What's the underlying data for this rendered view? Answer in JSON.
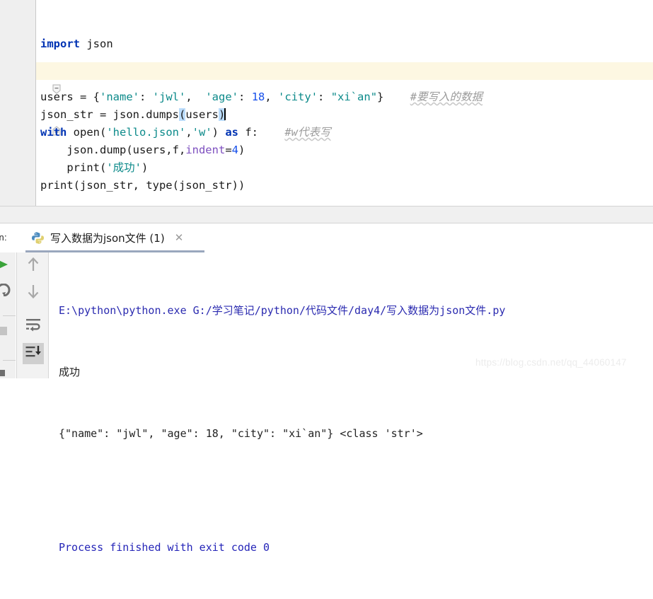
{
  "editor": {
    "lines": [
      {
        "id": "line-import",
        "tokens": [
          {
            "t": "import",
            "c": "kw"
          },
          {
            "t": " json",
            "c": "plain"
          }
        ]
      },
      {
        "id": "line-blank-1",
        "tokens": []
      },
      {
        "id": "line-blank-2",
        "tokens": []
      },
      {
        "id": "line-users",
        "tokens": [
          {
            "t": "users = {",
            "c": "plain"
          },
          {
            "t": "'name'",
            "c": "str"
          },
          {
            "t": ": ",
            "c": "plain"
          },
          {
            "t": "'jwl'",
            "c": "str"
          },
          {
            "t": ",  ",
            "c": "plain"
          },
          {
            "t": "'age'",
            "c": "str"
          },
          {
            "t": ": ",
            "c": "plain"
          },
          {
            "t": "18",
            "c": "num"
          },
          {
            "t": ", ",
            "c": "plain"
          },
          {
            "t": "'city'",
            "c": "str"
          },
          {
            "t": ": ",
            "c": "plain"
          },
          {
            "t": "\"xi`an\"",
            "c": "str"
          },
          {
            "t": "}",
            "c": "plain"
          }
        ],
        "comment": "#要写入的数据"
      },
      {
        "id": "line-json-str",
        "highlighted": true,
        "tokens": [
          {
            "t": "json_str = json.dumps",
            "c": "plain"
          },
          {
            "t": "(",
            "c": "plain brace-hl"
          },
          {
            "t": "users",
            "c": "plain"
          },
          {
            "t": ")",
            "c": "plain brace-hl"
          }
        ],
        "caret": true
      },
      {
        "id": "line-with-open",
        "tokens": [
          {
            "t": "with",
            "c": "kw"
          },
          {
            "t": " open(",
            "c": "plain"
          },
          {
            "t": "'hello.json'",
            "c": "str"
          },
          {
            "t": ",",
            "c": "plain"
          },
          {
            "t": "'w'",
            "c": "str"
          },
          {
            "t": ") ",
            "c": "plain"
          },
          {
            "t": "as",
            "c": "kw"
          },
          {
            "t": " f:",
            "c": "plain"
          }
        ],
        "comment": "#w代表写"
      },
      {
        "id": "line-json-dump",
        "tokens": [
          {
            "t": "    json.dump(users,f,",
            "c": "plain"
          },
          {
            "t": "indent",
            "c": "named"
          },
          {
            "t": "=",
            "c": "plain"
          },
          {
            "t": "4",
            "c": "num"
          },
          {
            "t": ")",
            "c": "plain"
          }
        ]
      },
      {
        "id": "line-print-success",
        "tokens": [
          {
            "t": "    print(",
            "c": "plain"
          },
          {
            "t": "'成功'",
            "c": "str"
          },
          {
            "t": ")",
            "c": "plain"
          }
        ]
      },
      {
        "id": "line-print-jsonstr",
        "tokens": [
          {
            "t": "print(json_str, ",
            "c": "plain"
          },
          {
            "t": "type",
            "c": "plain"
          },
          {
            "t": "(json_str))",
            "c": "plain"
          }
        ]
      }
    ]
  },
  "panel": {
    "run_label": "un:",
    "tab": {
      "icon": "python-icon",
      "label": "写入数据为json文件 (1)",
      "close": "✕"
    },
    "toolbar": [
      {
        "name": "scroll-up-button",
        "icon": "arrow-up-icon",
        "selected": false
      },
      {
        "name": "scroll-down-button",
        "icon": "arrow-down-icon",
        "selected": false
      },
      {
        "name": "soft-wrap-button",
        "icon": "soft-wrap-icon",
        "selected": false
      },
      {
        "name": "scroll-to-end-button",
        "icon": "scroll-to-end-icon",
        "selected": true
      }
    ],
    "edge_toolbar": [
      {
        "name": "run-button",
        "icon": "play-icon"
      },
      {
        "name": "rerun-button",
        "icon": "rerun-icon"
      },
      {
        "name": "stop-button",
        "icon": "stop-icon"
      },
      {
        "name": "pin-button",
        "icon": "pin-icon"
      }
    ],
    "console": {
      "command": "E:\\python\\python.exe G:/学习笔记/python/代码文件/day4/写入数据为json文件.py",
      "output_1": "成功",
      "output_2": "{\"name\": \"jwl\", \"age\": 18, \"city\": \"xi`an\"} <class 'str'>",
      "finished": "Process finished with exit code 0"
    }
  },
  "watermark": "https://blog.csdn.net/qq_44060147",
  "colors": {
    "keyword": "#0033b3",
    "string": "#0c8a8a",
    "number": "#1750eb",
    "comment": "#9b9b9b",
    "named_arg": "#7d4fbf",
    "caret_line": "#fdf7e2",
    "brace_match": "#bbdcfb",
    "console_path": "#2b2bb0",
    "tab_underline": "#9aa7bd"
  }
}
